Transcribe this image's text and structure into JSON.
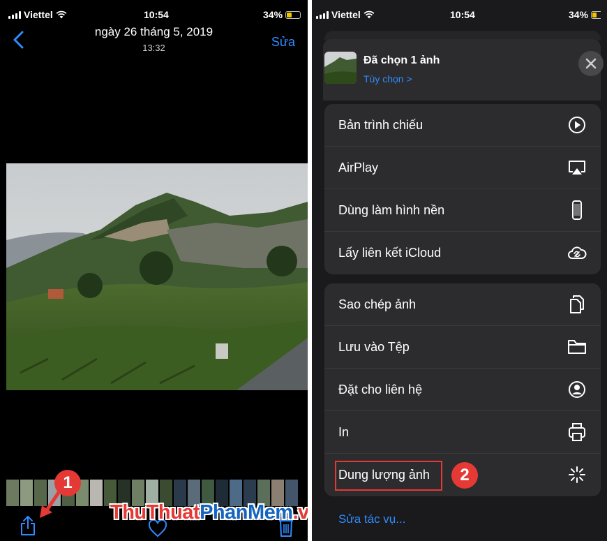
{
  "left": {
    "status": {
      "carrier": "Viettel",
      "time": "10:54",
      "battery": "34%"
    },
    "nav": {
      "title": "ngày 26 tháng 5, 2019",
      "subtitle": "13:32",
      "edit": "Sửa"
    },
    "badge": "1",
    "watermark": {
      "part1": "ThuThuat",
      "part2": "PhanMem",
      "part3": ".vn",
      "color1": "#e53935",
      "color2": "#1565c0"
    }
  },
  "right": {
    "status": {
      "carrier": "Viettel",
      "time": "10:54",
      "battery": "34%"
    },
    "header": {
      "title": "Đã chọn 1 ảnh",
      "options": "Tùy chọn >"
    },
    "group1": [
      {
        "label": "Bản trình chiếu",
        "icon": "play-icon"
      },
      {
        "label": "AirPlay",
        "icon": "airplay-icon"
      },
      {
        "label": "Dùng làm hình nền",
        "icon": "phone-icon"
      },
      {
        "label": "Lấy liên kết iCloud",
        "icon": "cloud-link-icon"
      }
    ],
    "group2": [
      {
        "label": "Sao chép ảnh",
        "icon": "copy-icon"
      },
      {
        "label": "Lưu vào Tệp",
        "icon": "folder-icon"
      },
      {
        "label": "Đặt cho liên hệ",
        "icon": "contact-icon"
      },
      {
        "label": "In",
        "icon": "printer-icon"
      },
      {
        "label": "Dung lượng ảnh",
        "icon": "sparkle-icon"
      }
    ],
    "badge": "2",
    "edit_actions": "Sửa tác vụ..."
  },
  "colors": {
    "accent": "#2f8cff",
    "highlight": "#e53935"
  }
}
